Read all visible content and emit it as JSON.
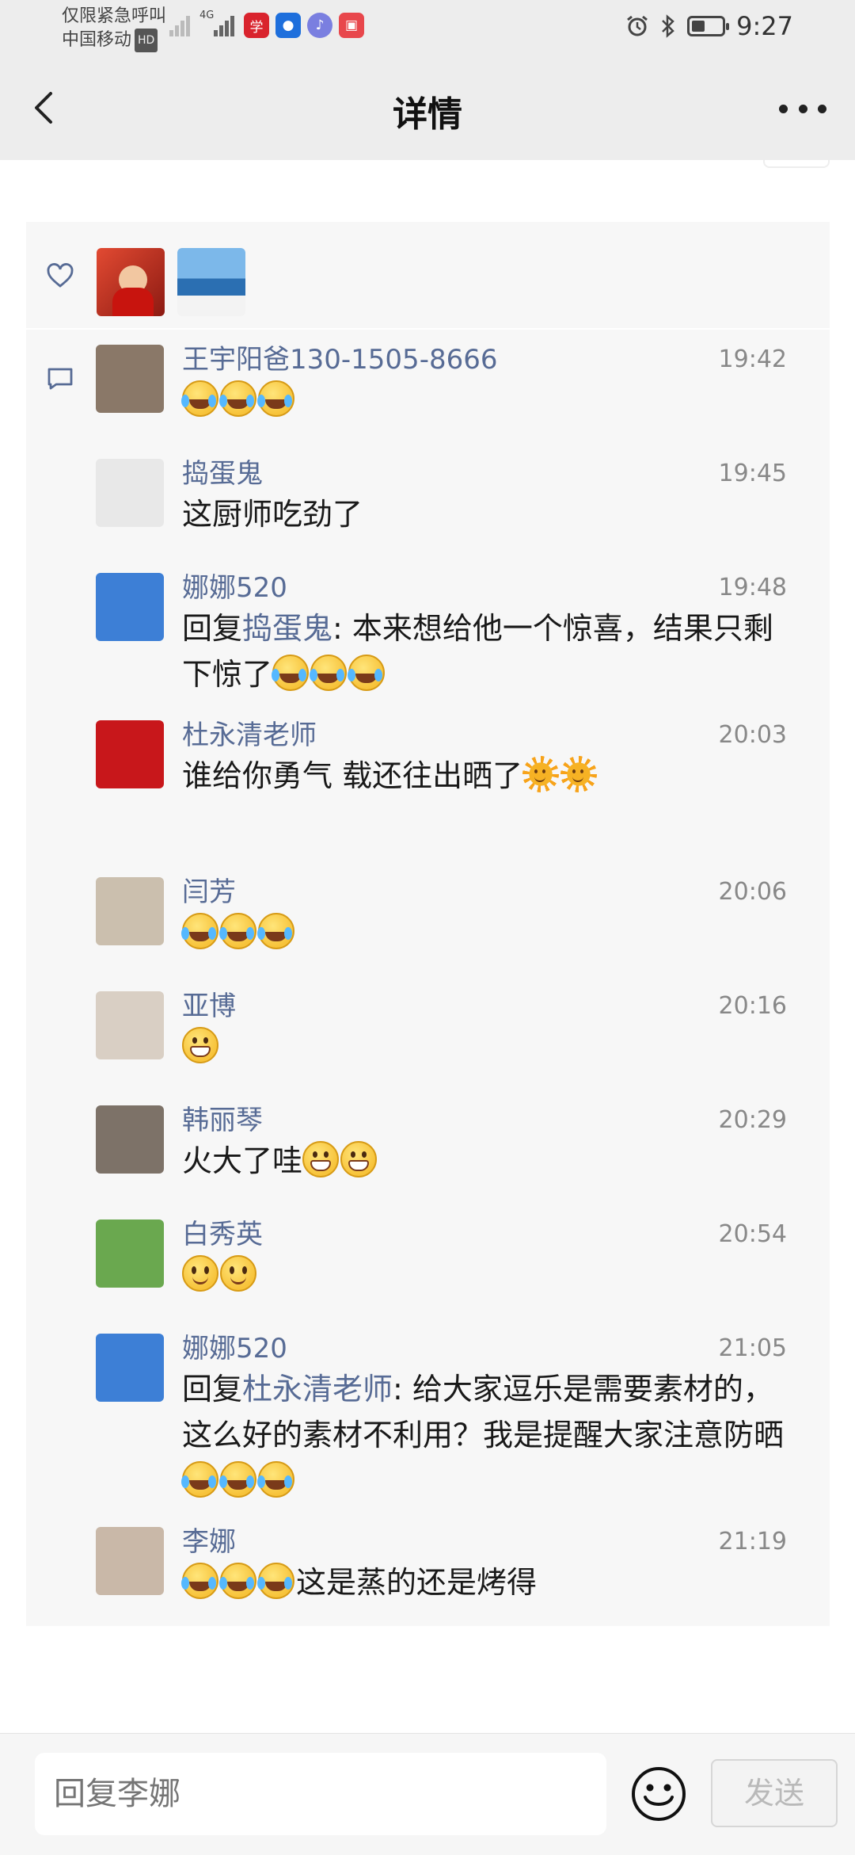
{
  "status_bar": {
    "carrier_line1": "仅限紧急呼叫",
    "carrier_line2": "中国移动",
    "hd_badge": "HD",
    "network": "4G",
    "time": "9:27",
    "icons": [
      "signal-x-icon",
      "signal-4g-icon",
      "news-app-icon",
      "bulb-app-icon",
      "music-app-icon",
      "book-app-icon",
      "alarm-icon",
      "bluetooth-icon",
      "battery-icon"
    ]
  },
  "header": {
    "title": "详情"
  },
  "likes": {
    "icon": "heart-icon",
    "avatars": [
      {
        "name": "liker-1",
        "color": "#c8402a"
      },
      {
        "name": "liker-2",
        "color": "#3c7fc4"
      }
    ]
  },
  "comments": [
    {
      "name": "王宇阳爸130-1505-8666",
      "time": "19:42",
      "prefix": "",
      "reply_to": "",
      "text": "",
      "emojis": [
        "laugh",
        "laugh",
        "laugh"
      ],
      "av": "#8a7868"
    },
    {
      "name": "捣蛋鬼",
      "time": "19:45",
      "prefix": "",
      "reply_to": "",
      "text": "这厨师吃劲了",
      "emojis": [],
      "av": "#e8e8e8"
    },
    {
      "name": "娜娜520",
      "time": "19:48",
      "prefix": "回复",
      "reply_to": "捣蛋鬼",
      "text": ": 本来想给他一个惊喜，结果只剩下惊了",
      "emojis": [
        "laugh",
        "laugh",
        "laugh"
      ],
      "av": "#3d7fd6"
    },
    {
      "name": "杜永清老师",
      "time": "20:03",
      "prefix": "",
      "reply_to": "",
      "text": "谁给你勇气 载还往出晒了",
      "emojis": [
        "sun",
        "sun"
      ],
      "av": "#c8171b",
      "extra_space": true
    },
    {
      "name": "闫芳",
      "time": "20:06",
      "prefix": "",
      "reply_to": "",
      "text": "",
      "emojis": [
        "laugh",
        "laugh",
        "laugh"
      ],
      "av": "#cbbfae"
    },
    {
      "name": "亚博",
      "time": "20:16",
      "prefix": "",
      "reply_to": "",
      "text": "",
      "emojis": [
        "grin"
      ],
      "av": "#d9cfc4"
    },
    {
      "name": "韩丽琴",
      "time": "20:29",
      "prefix": "",
      "reply_to": "",
      "text": "火大了哇",
      "emojis": [
        "grin",
        "grin"
      ],
      "av": "#7d7268"
    },
    {
      "name": "白秀英",
      "time": "20:54",
      "prefix": "",
      "reply_to": "",
      "text": "",
      "emojis": [
        "smile",
        "smile"
      ],
      "av": "#6aa84f"
    },
    {
      "name": "娜娜520",
      "time": "21:05",
      "prefix": "回复",
      "reply_to": "杜永清老师",
      "text": ": 给大家逗乐是需要素材的，这么好的素材不利用？我是提醒大家注意防晒",
      "emojis": [
        "laugh",
        "laugh",
        "laugh"
      ],
      "av": "#3d7fd6"
    },
    {
      "name": "李娜",
      "time": "21:19",
      "prefix": "",
      "reply_to": "",
      "text": "这是蒸的还是烤得",
      "emojis": [
        "laugh",
        "laugh",
        "laugh"
      ],
      "emoji_first": true,
      "av": "#c9b8a8"
    }
  ],
  "composer": {
    "placeholder": "回复李娜",
    "send_label": "发送"
  }
}
